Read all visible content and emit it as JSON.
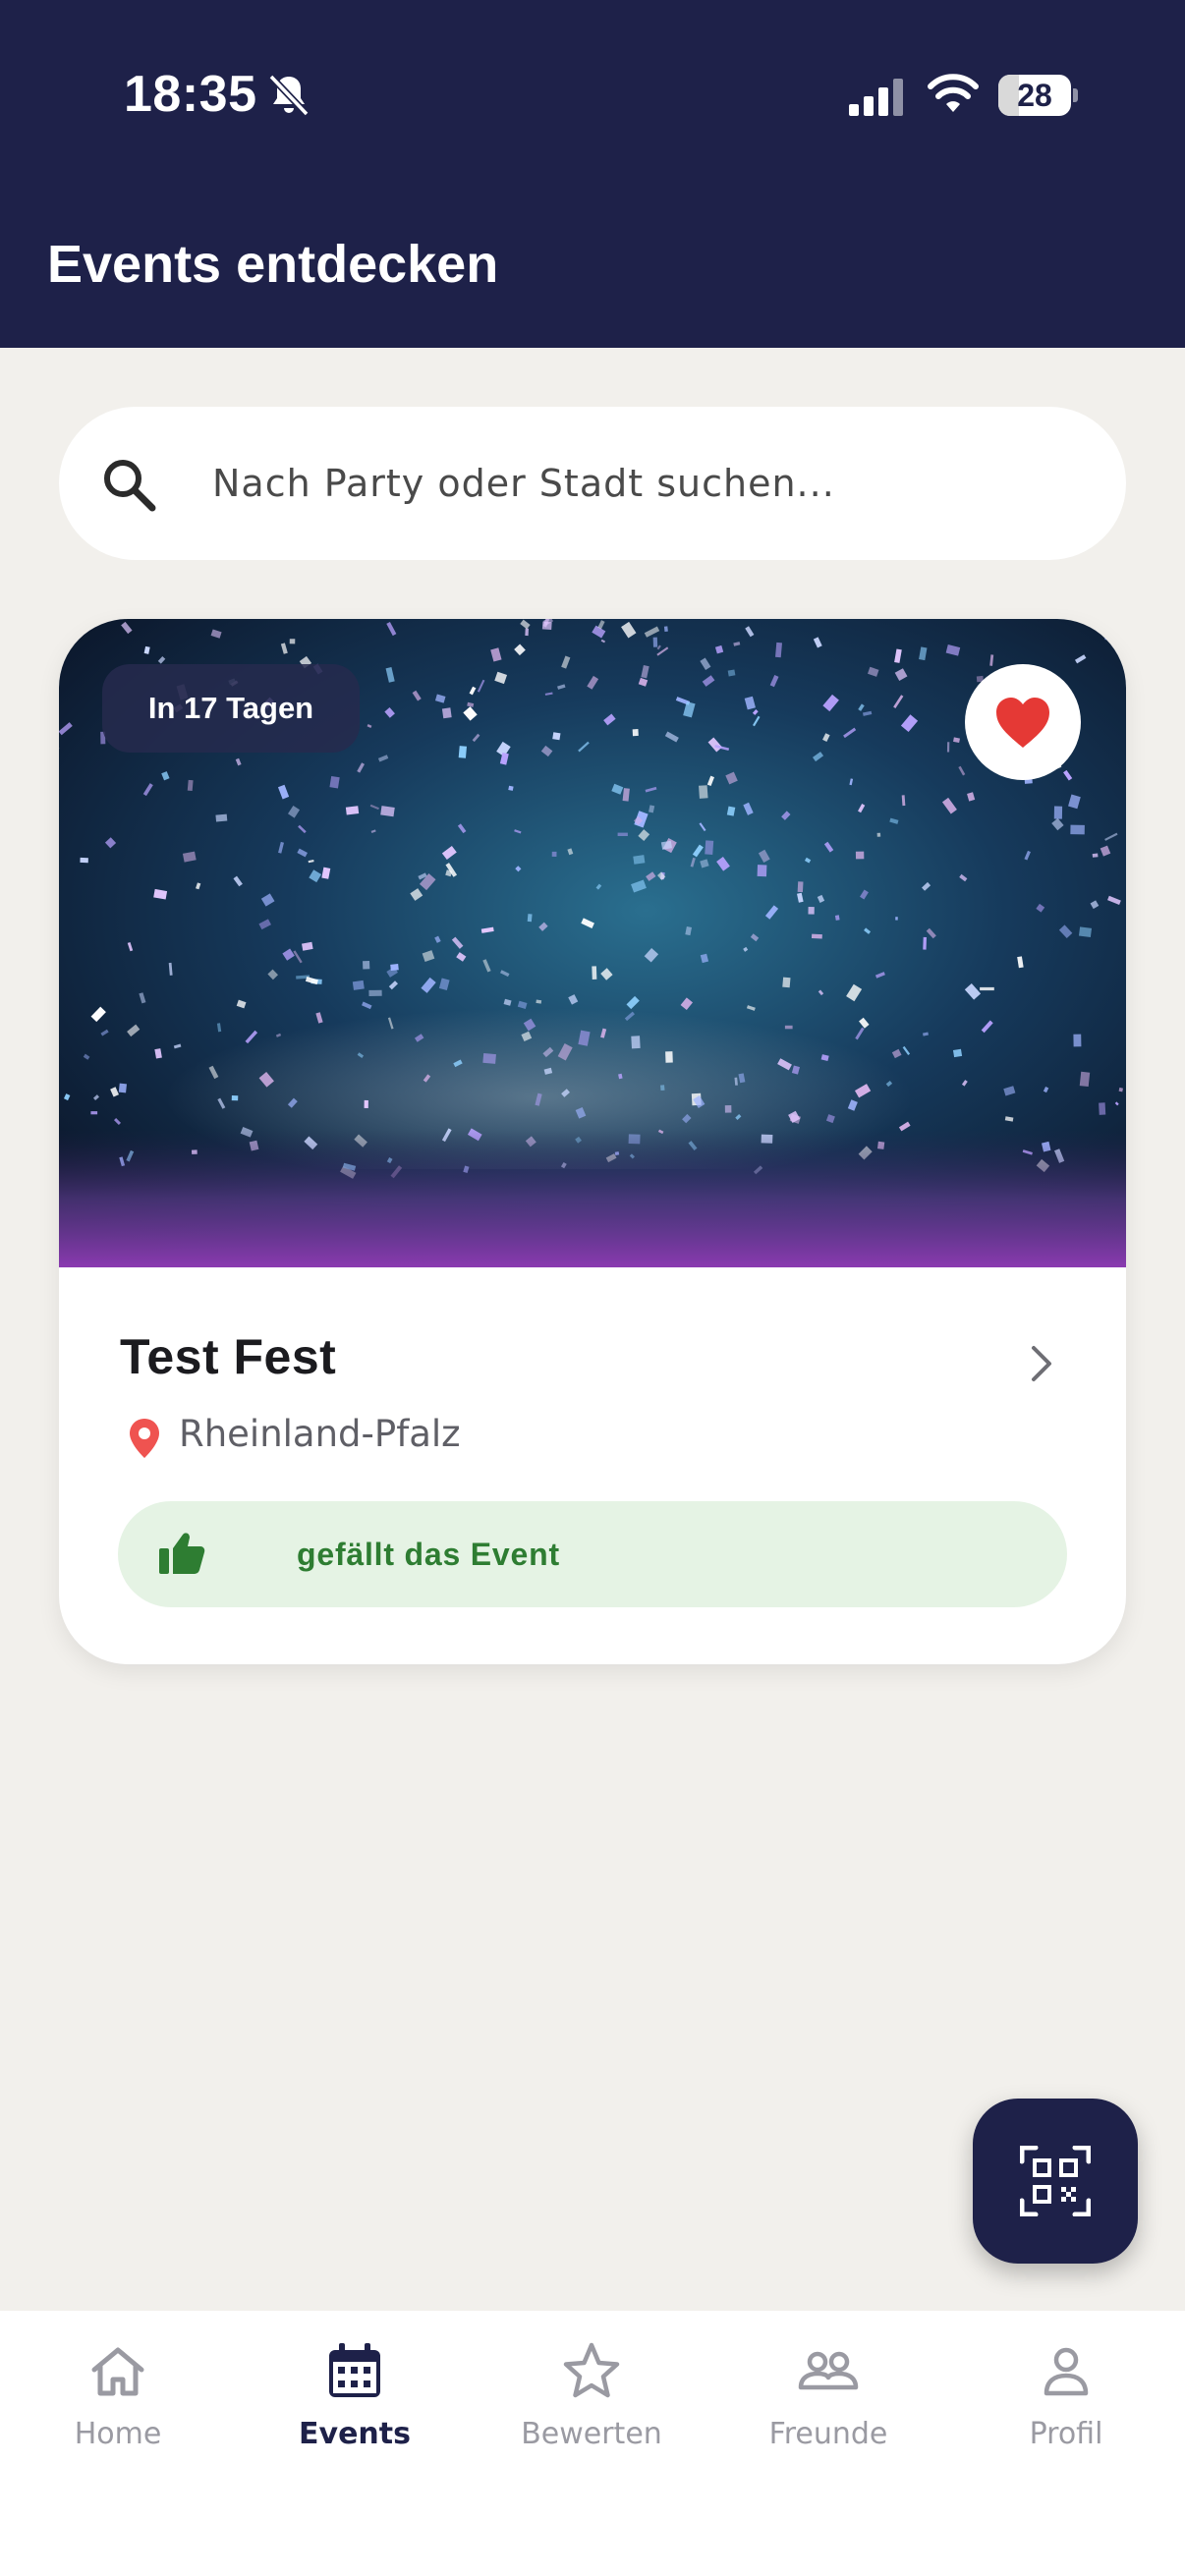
{
  "status_bar": {
    "time": "18:35",
    "battery_level": "28",
    "battery_fraction": 0.28,
    "icons": [
      "bell-slash-icon",
      "signal-icon",
      "wifi-icon",
      "battery-icon"
    ]
  },
  "header": {
    "title": "Events entdecken"
  },
  "search": {
    "placeholder": "Nach Party oder Stadt suchen...",
    "value": "",
    "icon": "search-icon"
  },
  "event_card": {
    "badge": "In 17 Tagen",
    "favorite_icon": "heart-icon",
    "title": "Test Fest",
    "location": "Rheinland-Pfalz",
    "like_label": "gefällt das Event",
    "colors": {
      "heart": "#e53935",
      "like_text": "#2e7d32",
      "like_background": "#e5f3e4",
      "pin": "#ef5350"
    }
  },
  "fab": {
    "icon": "qr-scan-icon"
  },
  "bottom_nav": {
    "active": "Events",
    "items": [
      {
        "label": "Home",
        "icon": "home-icon"
      },
      {
        "label": "Events",
        "icon": "calendar-icon"
      },
      {
        "label": "Bewerten",
        "icon": "star-icon"
      },
      {
        "label": "Freunde",
        "icon": "friends-icon"
      },
      {
        "label": "Profil",
        "icon": "profile-icon"
      }
    ]
  },
  "theme": {
    "primary": "#1e2149",
    "background": "#f2f0ec",
    "inactive": "#9a9aa2"
  }
}
